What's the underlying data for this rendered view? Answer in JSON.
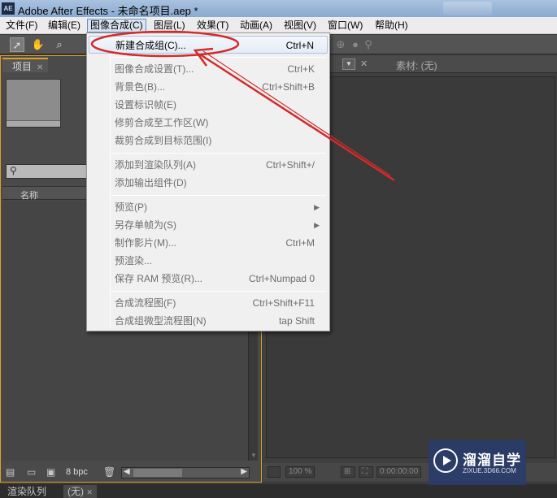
{
  "window": {
    "app_icon": "AE",
    "title": "Adobe After Effects - 未命名项目.aep *"
  },
  "menubar": {
    "items": [
      {
        "label": "文件(F)"
      },
      {
        "label": "编辑(E)"
      },
      {
        "label": "图像合成(C)"
      },
      {
        "label": "图层(L)"
      },
      {
        "label": "效果(T)"
      },
      {
        "label": "动画(A)"
      },
      {
        "label": "视图(V)"
      },
      {
        "label": "窗口(W)"
      },
      {
        "label": "帮助(H)"
      }
    ]
  },
  "toolbar": {
    "tools": [
      "selection-tool",
      "hand-tool",
      "zoom-tool"
    ]
  },
  "project_panel": {
    "tab_label": "项目",
    "column_name": "名称",
    "bit_depth": "8 bpc"
  },
  "viewer_panel": {
    "footage_tab": "素材: (无)",
    "zoom": "100 %",
    "timecode": "0:00:00:00"
  },
  "bottom_tabs": [
    {
      "label": "渲染队列"
    },
    {
      "label": "(无)"
    }
  ],
  "dropdown": {
    "items": [
      {
        "label": "新建合成组(C)...",
        "shortcut": "Ctrl+N"
      },
      {
        "label": "图像合成设置(T)...",
        "shortcut": "Ctrl+K"
      },
      {
        "label": "背景色(B)...",
        "shortcut": "Ctrl+Shift+B"
      },
      {
        "label": "设置标识帧(E)",
        "shortcut": ""
      },
      {
        "label": "修剪合成至工作区(W)",
        "shortcut": ""
      },
      {
        "label": "裁剪合成到目标范围(I)",
        "shortcut": ""
      },
      {
        "label": "添加到渲染队列(A)",
        "shortcut": "Ctrl+Shift+/"
      },
      {
        "label": "添加输出组件(D)",
        "shortcut": ""
      },
      {
        "label": "预览(P)",
        "shortcut": ""
      },
      {
        "label": "另存单帧为(S)",
        "shortcut": ""
      },
      {
        "label": "制作影片(M)...",
        "shortcut": "Ctrl+M"
      },
      {
        "label": "预渲染...",
        "shortcut": ""
      },
      {
        "label": "保存 RAM 预览(R)...",
        "shortcut": "Ctrl+Numpad 0"
      },
      {
        "label": "合成流程图(F)",
        "shortcut": "Ctrl+Shift+F11"
      },
      {
        "label": "合成组微型流程图(N)",
        "shortcut": "tap Shift"
      }
    ]
  },
  "annotation": {
    "color": "#d42a2a"
  },
  "watermark": {
    "name": "溜溜自学",
    "url": "ZIXUE.3D66.COM"
  }
}
